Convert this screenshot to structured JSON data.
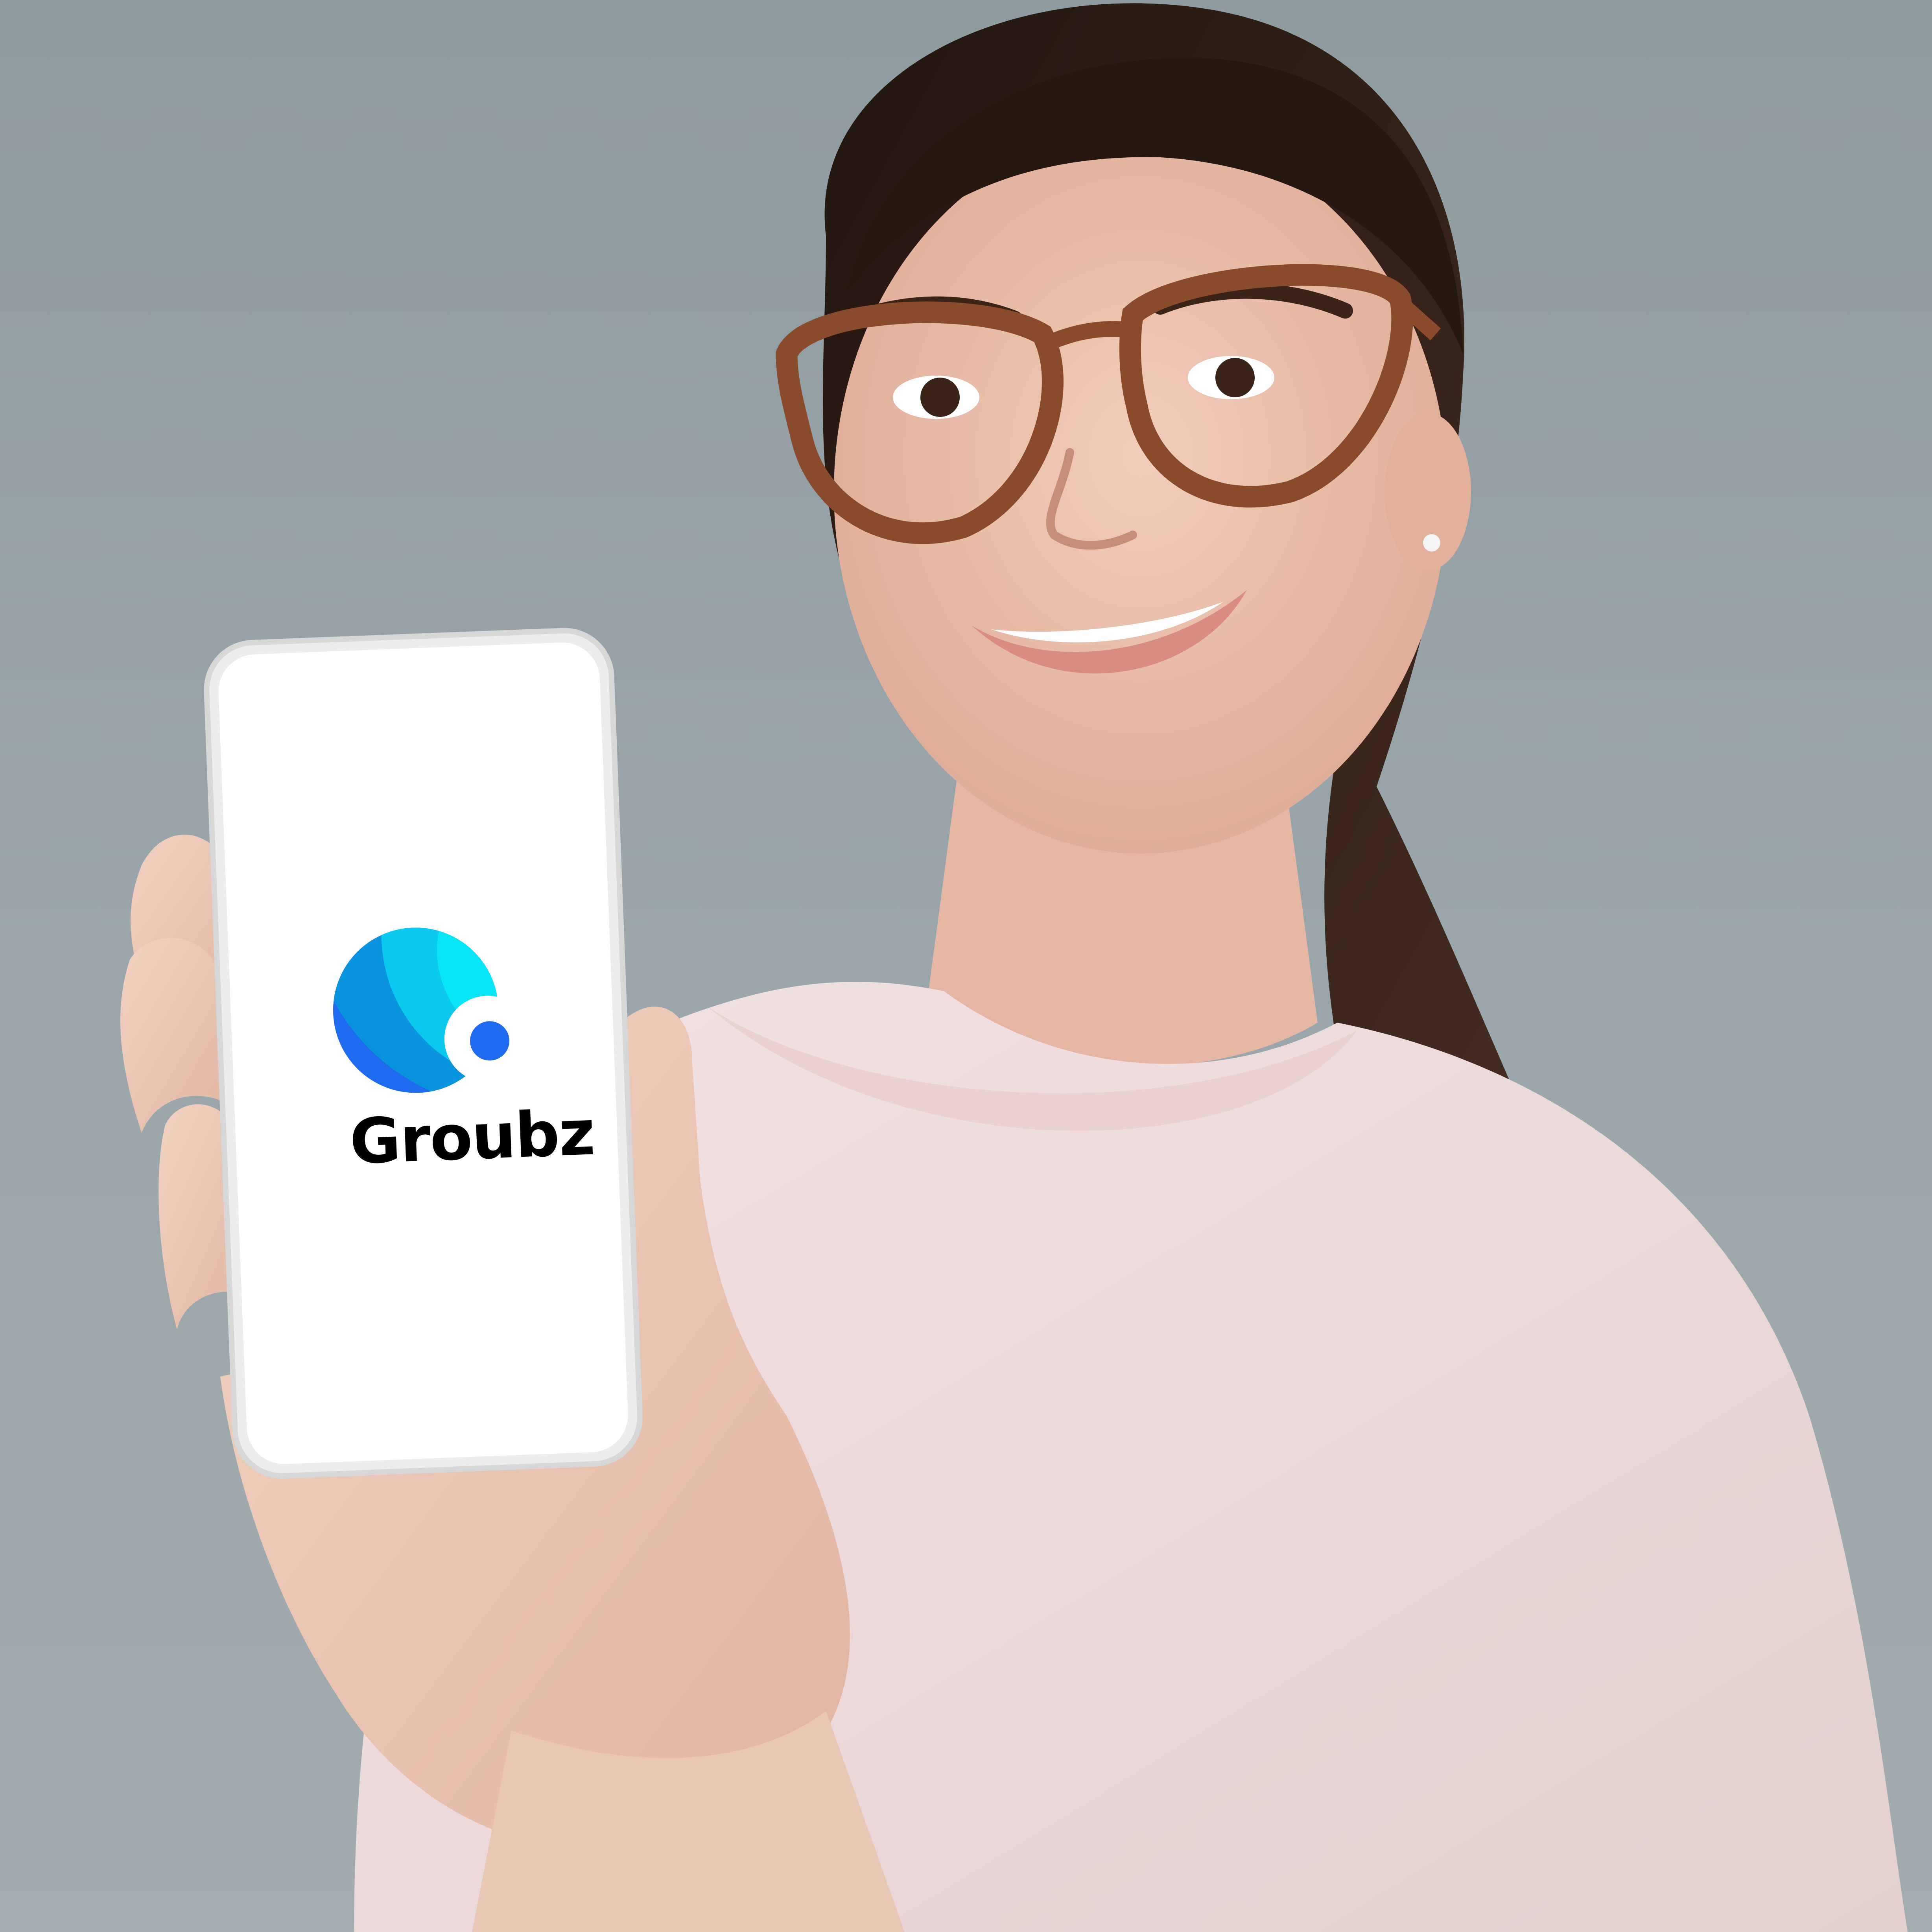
{
  "phone_screen": {
    "app_name": "Groubz"
  },
  "logo": {
    "icon": "groubz-logo-icon",
    "colors": [
      "#1E6BF0",
      "#0A94DD",
      "#0AC8EE",
      "#08E4F8",
      "#1E6BF0"
    ]
  },
  "scene": {
    "background_color": "#98A4A9",
    "top_color": "#8C9A9F",
    "shirt_color": "#EEDCDC",
    "skin_color": "#EDC4B1",
    "hair_color": "#2A1C17",
    "glasses_color": "#8A4A2C",
    "phone_body_color": "#EDEDED",
    "phone_screen_color": "#FFFFFF"
  }
}
